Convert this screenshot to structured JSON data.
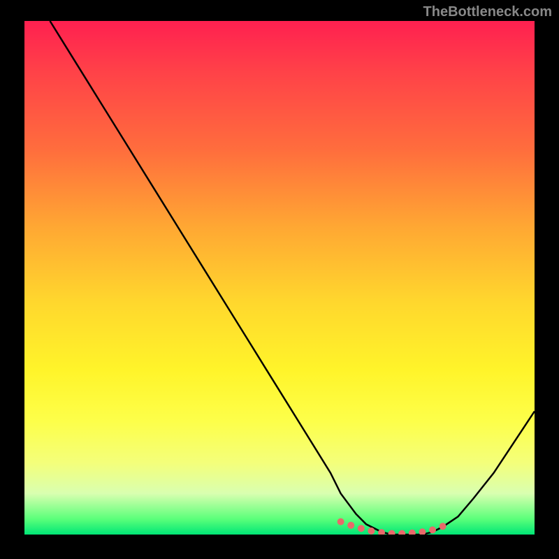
{
  "watermark": "TheBottleneck.com",
  "chart_data": {
    "type": "line",
    "title": "",
    "xlabel": "",
    "ylabel": "",
    "xlim": [
      0,
      100
    ],
    "ylim": [
      0,
      100
    ],
    "series": [
      {
        "name": "bottleneck-curve",
        "x": [
          5,
          10,
          15,
          20,
          25,
          30,
          35,
          40,
          45,
          50,
          55,
          60,
          62,
          65,
          67,
          70,
          72,
          75,
          78,
          80,
          82,
          85,
          88,
          92,
          96,
          100
        ],
        "values": [
          100,
          92,
          84,
          76,
          68,
          60,
          52,
          44,
          36,
          28,
          20,
          12,
          8,
          4,
          2,
          0.5,
          0,
          0,
          0,
          0.5,
          1.5,
          3.5,
          7,
          12,
          18,
          24
        ]
      }
    ],
    "markers": {
      "name": "highlight-dots",
      "x": [
        62,
        64,
        66,
        68,
        70,
        72,
        74,
        76,
        78,
        80,
        82
      ],
      "values": [
        2.5,
        1.8,
        1.2,
        0.7,
        0.4,
        0.2,
        0.2,
        0.3,
        0.5,
        0.9,
        1.6
      ],
      "color": "#e86a6a"
    },
    "gradient_stops": [
      {
        "pos": 0,
        "color": "#ff2050"
      },
      {
        "pos": 50,
        "color": "#ffd82d"
      },
      {
        "pos": 100,
        "color": "#00e676"
      }
    ]
  }
}
